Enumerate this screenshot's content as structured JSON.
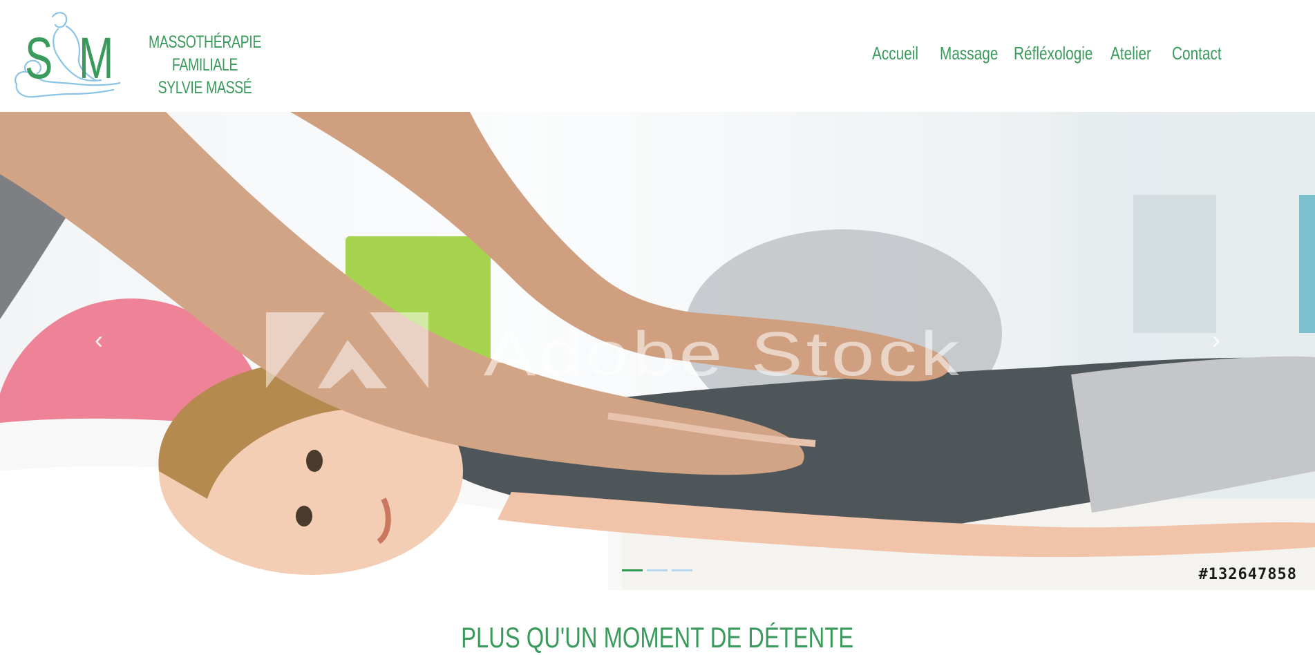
{
  "brand": {
    "logo_letters": [
      "S",
      "M"
    ],
    "line1": "MASSOTHÉRAPIE FAMILIALE",
    "line2": "SYLVIE MASSÉ",
    "color": "#3a9a5b",
    "logo_figure_color": "#8cc4e8"
  },
  "nav": {
    "items": [
      {
        "label": "Accueil"
      },
      {
        "label": "Massage"
      },
      {
        "label": "Réfléxologie"
      },
      {
        "label": "Atelier"
      },
      {
        "label": "Contact"
      }
    ]
  },
  "hero": {
    "watermark": "Adobe Stock",
    "stock_id": "#132647858",
    "prev_icon": "chevron-left-icon",
    "next_icon": "chevron-right-icon",
    "prev_glyph": "‹",
    "next_glyph": "›",
    "slides_count": 3,
    "active_slide": 1,
    "indicator_active_color": "#2f9a4f",
    "indicator_color": "#b8d8ee"
  },
  "section": {
    "title": "PLUS QU'UN MOMENT DE DÉTENTE"
  }
}
